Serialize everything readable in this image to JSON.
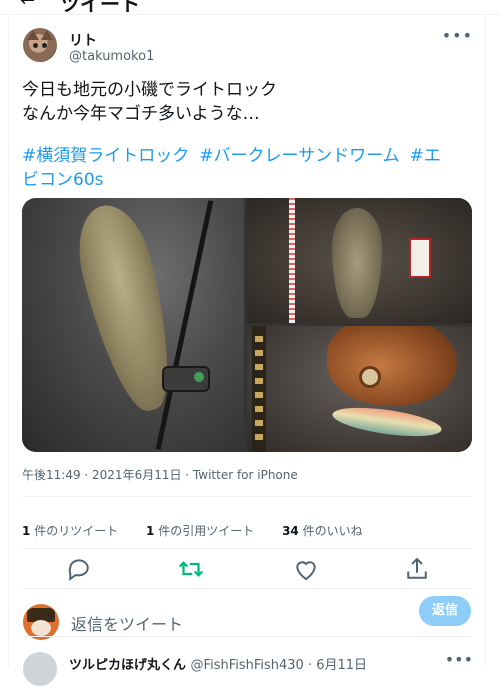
{
  "header": {
    "back_icon": "arrow-left-icon",
    "title": "ツイート"
  },
  "tweet": {
    "name": "リト",
    "handle": "@takumoko1",
    "text_line1": "今日も地元の小磯でライトロック",
    "text_line2": "なんか今年マゴチ多いような…",
    "hashtags": [
      "#横須賀ライトロック",
      "#バークレーサンドワーム",
      "#エ"
    ],
    "hashtag_wrap": "ビコン60s",
    "meta": "午後11:49 · 2021年6月11日 · Twitter for iPhone",
    "stats": [
      {
        "count": "1",
        "label": "件のリツイート"
      },
      {
        "count": "1",
        "label": "件の引用ツイート"
      },
      {
        "count": "34",
        "label": "件のいいね"
      }
    ]
  },
  "actions": [
    {
      "icon": "reply-icon"
    },
    {
      "icon": "retweet-icon",
      "color": "#00ba7c"
    },
    {
      "icon": "like-icon"
    },
    {
      "icon": "share-icon"
    }
  ],
  "composer": {
    "placeholder": "返信をツイート",
    "button": "返信"
  },
  "next_reply": {
    "name": "ツルピカほげ丸くん",
    "handle_date": "@FishFishFish430 · 6月11日"
  },
  "colors": {
    "accent": "#1d9bf0",
    "retweet": "#00ba7c",
    "reply_button": "#8ecdf8"
  }
}
